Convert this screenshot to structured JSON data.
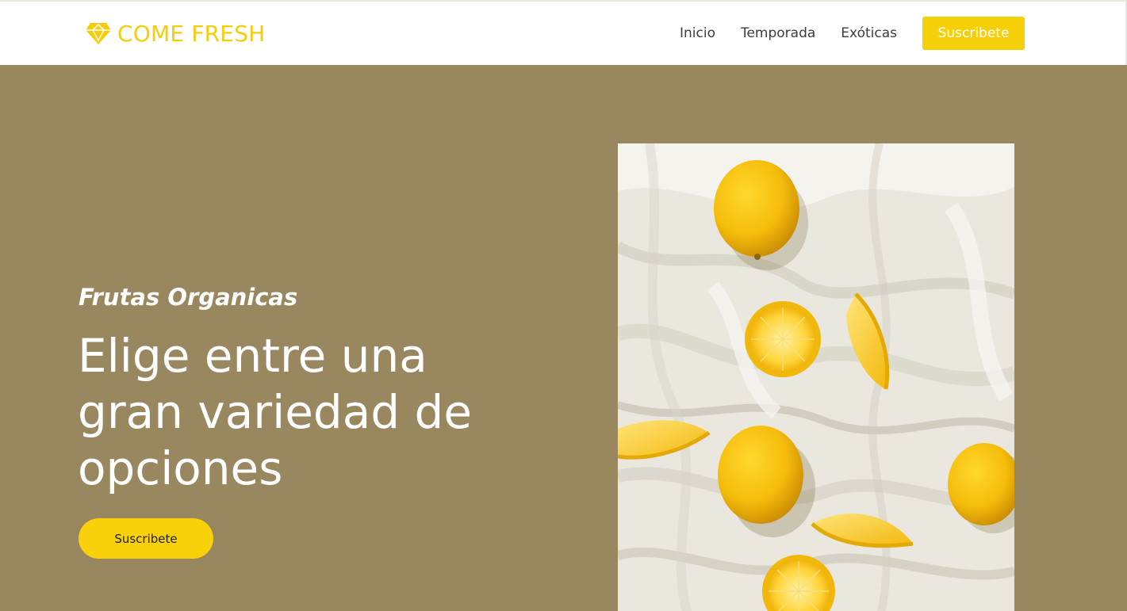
{
  "brand": {
    "name": "COME FRESH",
    "icon": "diamond-icon",
    "color": "#f6cd0a"
  },
  "nav": {
    "items": [
      {
        "label": "Inicio"
      },
      {
        "label": "Temporada"
      },
      {
        "label": "Exóticas"
      }
    ],
    "cta_label": "Suscribete"
  },
  "hero": {
    "kicker": "Frutas Organicas",
    "headline": "Elige entre una gran variedad de opciones",
    "cta_label": "Suscribete",
    "image_subject": "lemons-on-white-linen",
    "background_color": "#998760",
    "accent_color": "#f8d10a"
  }
}
